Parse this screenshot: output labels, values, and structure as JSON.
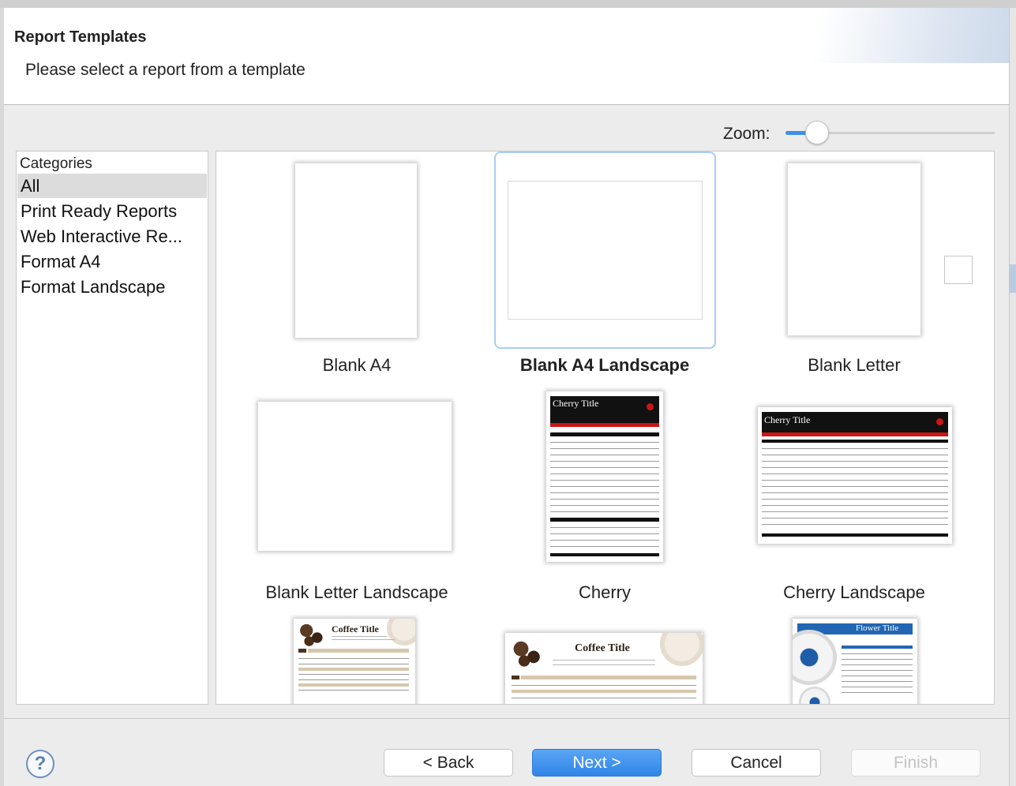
{
  "header": {
    "title": "Report Templates",
    "subtitle": "Please select a report from a template"
  },
  "zoom": {
    "label": "Zoom:",
    "level": 0.15
  },
  "categories": {
    "header": "Categories",
    "items": [
      {
        "label": "All",
        "selected": true
      },
      {
        "label": "Print Ready Reports",
        "selected": false
      },
      {
        "label": "Web Interactive Re...",
        "selected": false
      },
      {
        "label": "Format A4",
        "selected": false
      },
      {
        "label": "Format Landscape",
        "selected": false
      }
    ]
  },
  "templates": [
    {
      "label": "Blank A4",
      "selected": false
    },
    {
      "label": "Blank A4 Landscape",
      "selected": true
    },
    {
      "label": "Blank Letter",
      "selected": false
    },
    {
      "label": "Blank Letter Landscape",
      "selected": false
    },
    {
      "label": "Cherry",
      "selected": false
    },
    {
      "label": "Cherry Landscape",
      "selected": false
    }
  ],
  "previews": {
    "cherry_title": "Cherry Title",
    "coffee_title": "Coffee Title",
    "flower_title": "Flower Title"
  },
  "buttons": {
    "help": "?",
    "back": "< Back",
    "next": "Next >",
    "cancel": "Cancel",
    "finish": "Finish"
  },
  "colors": {
    "accent": "#2f84e6",
    "selection_border": "#a8cdf4",
    "cherry_red": "#cc1515"
  }
}
